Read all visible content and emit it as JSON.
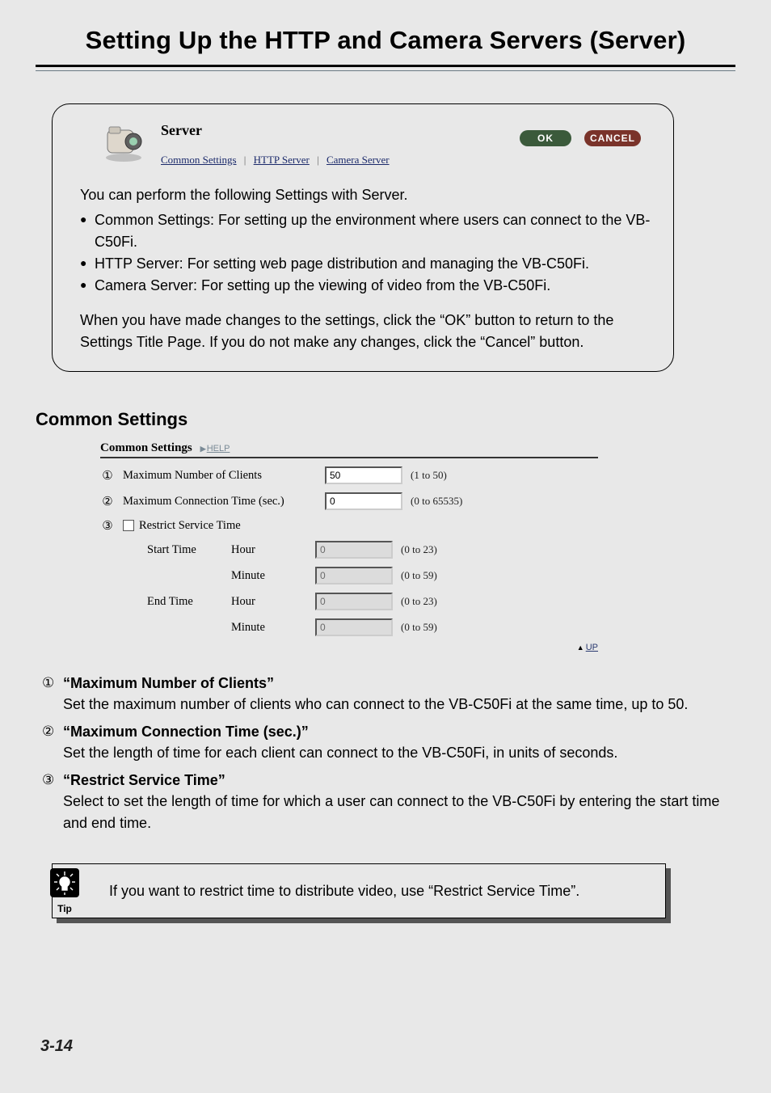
{
  "page": {
    "title": "Setting Up the HTTP and Camera Servers (Server)",
    "number": "3-14"
  },
  "intro": {
    "server_label": "Server",
    "ok_label": "OK",
    "cancel_label": "CANCEL",
    "links": {
      "common": "Common Settings",
      "http": "HTTP Server",
      "camera": "Camera Server"
    },
    "lead": "You can perform the following Settings with Server.",
    "bullets": {
      "b1": "Common Settings: For setting up the environment where users can connect to the VB-C50Fi.",
      "b2": "HTTP Server: For setting web page distribution and managing the VB-C50Fi.",
      "b3": "Camera Server: For setting up the viewing of video from the VB-C50Fi."
    },
    "closing": "When you have made changes to the settings, click the “OK” button to return to the Settings Title Page. If you do not make any changes, click the “Cancel” button."
  },
  "section": {
    "heading": "Common Settings"
  },
  "panel": {
    "title": "Common Settings",
    "help": "HELP",
    "rows": {
      "max_clients": {
        "label": "Maximum Number of Clients",
        "value": "50",
        "range": "(1 to 50)"
      },
      "max_conn": {
        "label": "Maximum Connection Time (sec.)",
        "value": "0",
        "range": "(0 to 65535)"
      },
      "restrict": {
        "label": "Restrict Service Time"
      },
      "start": {
        "label": "Start Time"
      },
      "end": {
        "label": "End Time"
      },
      "hour": {
        "label": "Hour",
        "range": "(0 to 23)",
        "value": "0"
      },
      "minute": {
        "label": "Minute",
        "range": "(0 to 59)",
        "value": "0"
      }
    },
    "up": "UP"
  },
  "markers": {
    "m1": "①",
    "m2": "②",
    "m3": "③"
  },
  "defs": {
    "d1": {
      "title": "“Maximum Number of Clients”",
      "text": "Set the maximum number of clients who can connect to the VB-C50Fi at the same time, up to 50."
    },
    "d2": {
      "title": "“Maximum Connection Time (sec.)”",
      "text": "Set the length of time for each client can connect to the VB-C50Fi, in units of seconds."
    },
    "d3": {
      "title": "“Restrict Service Time”",
      "text": "Select to set the length of time for which a user can connect to the VB-C50Fi by entering the start time and end time."
    }
  },
  "tip": {
    "label": "Tip",
    "text": "If you want to restrict time to distribute video, use “Restrict Service Time”."
  }
}
